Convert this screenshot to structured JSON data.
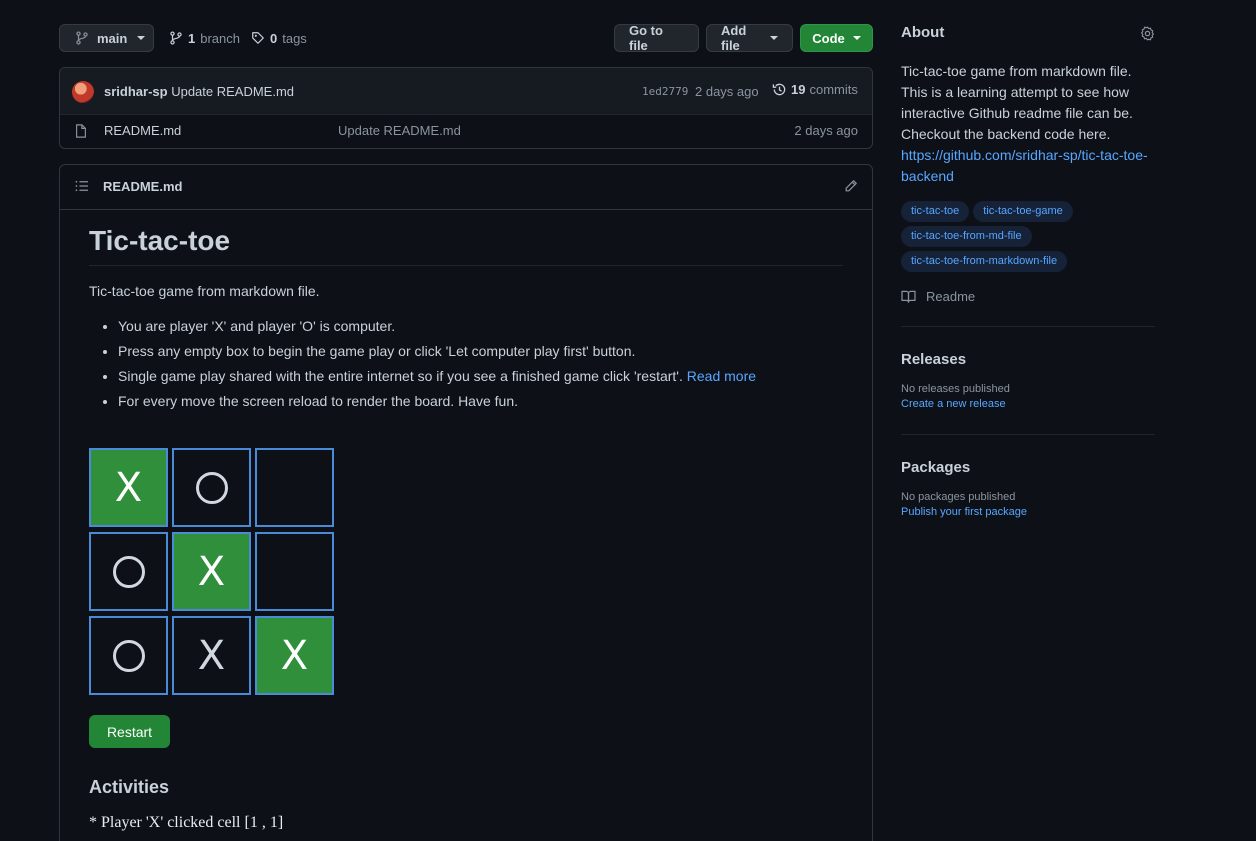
{
  "toolbar": {
    "branch": "main",
    "branches_count": "1",
    "branches_label": "branch",
    "tags_count": "0",
    "tags_label": "tags",
    "go_to_file": "Go to file",
    "add_file": "Add file",
    "code": "Code"
  },
  "commit": {
    "author": "sridhar-sp",
    "message": "Update README.md",
    "hash": "1ed2779",
    "time": "2 days ago",
    "commits_count": "19",
    "commits_label": "commits"
  },
  "files": [
    {
      "name": "README.md",
      "message": "Update README.md",
      "time": "2 days ago"
    }
  ],
  "readme": {
    "filename": "README.md",
    "title": "Tic-tac-toe",
    "description": "Tic-tac-toe game from markdown file.",
    "bullets": [
      "You are player 'X' and player 'O' is computer.",
      "Press any empty box to begin the game play or click 'Let computer play first' button.",
      "Single game play shared with the entire internet so if you see a finished game click 'restart'.",
      "For every move the screen reload to render the board. Have fun."
    ],
    "read_more": "Read more",
    "board": [
      [
        "X",
        "O",
        ""
      ],
      [
        "O",
        "X",
        ""
      ],
      [
        "O",
        "X",
        "X"
      ]
    ],
    "winning_cells": [
      [
        0,
        0
      ],
      [
        1,
        1
      ],
      [
        2,
        2
      ]
    ],
    "restart": "Restart",
    "activities_title": "Activities",
    "activities": [
      "* Player 'X' clicked cell [1 , 1]"
    ]
  },
  "sidebar": {
    "about_title": "About",
    "about_description": "Tic-tac-toe game from markdown file. This is a learning attempt to see how interactive Github readme file can be. Checkout the backend code here.",
    "backend_link": "https://github.com/sridhar-sp/tic-tac-toe-backend",
    "topics": [
      "tic-tac-toe",
      "tic-tac-toe-game",
      "tic-tac-toe-from-md-file",
      "tic-tac-toe-from-markdown-file"
    ],
    "readme_label": "Readme",
    "releases_title": "Releases",
    "releases_empty": "No releases published",
    "releases_link": "Create a new release",
    "packages_title": "Packages",
    "packages_empty": "No packages published",
    "packages_link": "Publish your first package"
  },
  "colors": {
    "background": "#0d1117",
    "primary_button": "#238636",
    "winning_cell": "#2f8f3a",
    "cell_border": "#4a8bd8",
    "link": "#58a6ff"
  }
}
